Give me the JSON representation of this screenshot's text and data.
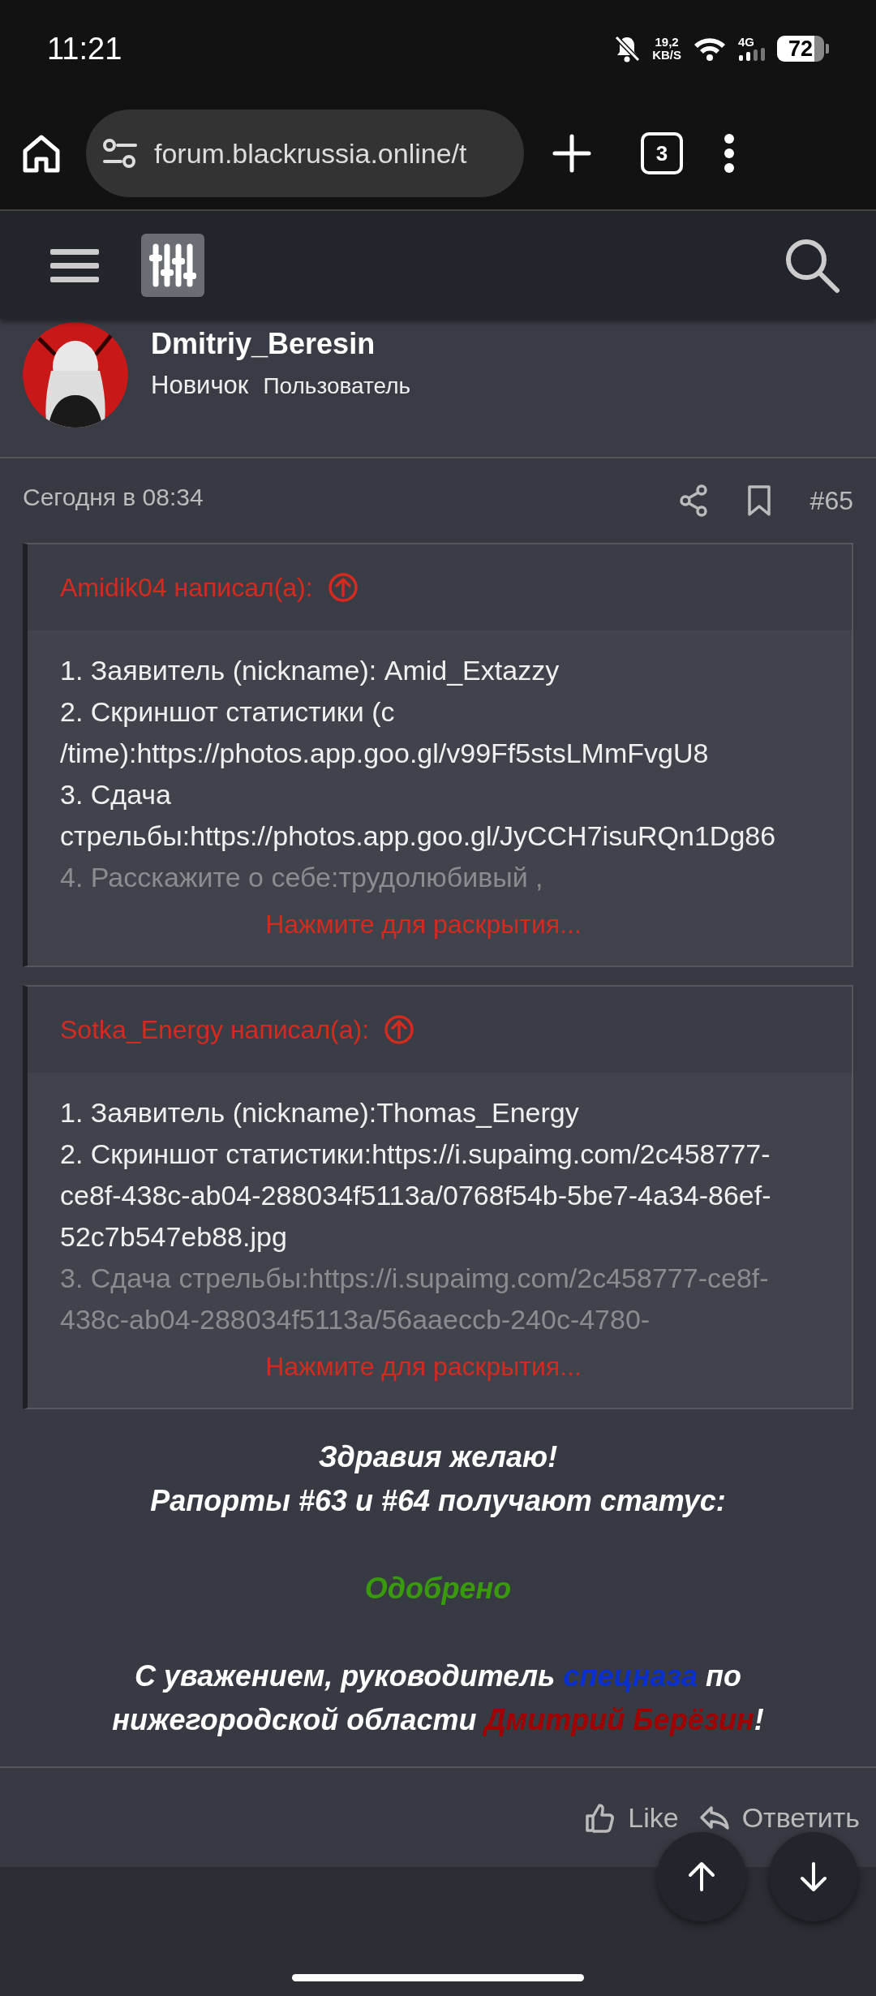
{
  "status_bar": {
    "time": "11:21",
    "speed": "19,2",
    "speed_unit": "KB/S",
    "network": "4G",
    "battery": "72"
  },
  "browser": {
    "url": "forum.blackrussia.online/t",
    "tab_count": "3"
  },
  "post": {
    "author": "Dmitriy_Beresin",
    "rank": "Новичок",
    "role": "Пользователь",
    "date": "Сегодня в 08:34",
    "number": "#65",
    "quotes": [
      {
        "author": "Amidik04 написал(а):",
        "expand": "Нажмите для раскрытия...",
        "lines": [
          {
            "text": "1. Заявитель (nickname): Amid_Extazzy",
            "faded": false
          },
          {
            "text": "2. Скриншот статистики (с /time):https://photos.app.goo.gl/v99Ff5stsLMmFvgU8",
            "faded": false
          },
          {
            "text": "3. Сдача стрельбы:https://photos.app.goo.gl/JyCCH7isuRQn1Dg86",
            "faded": false
          },
          {
            "text": "4. Расскажите о себе:трудолюбивый ,",
            "faded": true
          }
        ]
      },
      {
        "author": "Sotka_Energy написал(а):",
        "expand": "Нажмите для раскрытия...",
        "lines": [
          {
            "text": "1. Заявитель (nickname):Thomas_Energy",
            "faded": false
          },
          {
            "text": "2. Скриншот статистики:https://i.supaimg.com/2c458777-ce8f-438c-ab04-288034f5113a/0768f54b-5be7-4a34-86ef-52c7b547eb88.jpg",
            "faded": false
          },
          {
            "text": "3. Сдача стрельбы:https://i.supaimg.com/2c458777-ce8f-438c-ab04-288034f5113a/56aaeccb-240c-4780-",
            "faded": true
          }
        ]
      }
    ],
    "message": [
      {
        "kind": "line",
        "segments": [
          {
            "text": "Здравия желаю!",
            "color": "#ffffff"
          }
        ]
      },
      {
        "kind": "line",
        "segments": [
          {
            "text": "Рапорты #63 и #64 получают статус:",
            "color": "#ffffff"
          }
        ]
      },
      {
        "kind": "blank"
      },
      {
        "kind": "line",
        "segments": [
          {
            "text": "Одобрено",
            "color": "#3a9a0e"
          }
        ]
      },
      {
        "kind": "blank"
      },
      {
        "kind": "line",
        "segments": [
          {
            "text": "С уважением, руководитель ",
            "color": "#ffffff"
          },
          {
            "text": "спецназа",
            "color": "#0a2fd0"
          },
          {
            "text": " по нижегородской области ",
            "color": "#ffffff"
          },
          {
            "text": "Дмитрий Берёзин",
            "color": "#a00000"
          },
          {
            "text": "!",
            "color": "#ffffff"
          }
        ]
      }
    ],
    "reactions": [
      {
        "kind": "like",
        "label": "Like"
      },
      {
        "kind": "reply",
        "label": "Ответить"
      }
    ]
  }
}
